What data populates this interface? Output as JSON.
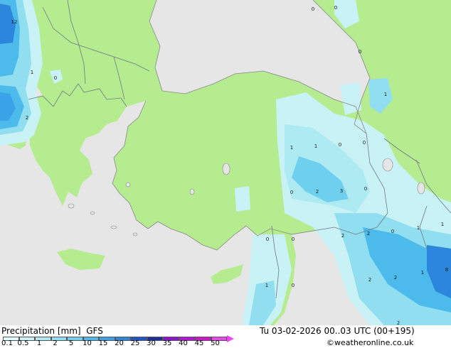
{
  "legend": {
    "title": "Precipitation [mm]",
    "model": "GFS",
    "datetime": "Tu 03-02-2026 00..03 UTC (00+195)",
    "credit": "©weatheronline.co.uk",
    "scale": [
      {
        "label": "0.1",
        "color": "#e0fafa"
      },
      {
        "label": "0.5",
        "color": "#c8f2f5"
      },
      {
        "label": "1",
        "color": "#aeeaf2"
      },
      {
        "label": "2",
        "color": "#90def0"
      },
      {
        "label": "5",
        "color": "#6ed0ee"
      },
      {
        "label": "10",
        "color": "#4cbbec"
      },
      {
        "label": "15",
        "color": "#3aa2e6"
      },
      {
        "label": "20",
        "color": "#2c86dc"
      },
      {
        "label": "25",
        "color": "#1f55c8"
      },
      {
        "label": "30",
        "color": "#1a2ea0"
      },
      {
        "label": "35",
        "color": "#8c14d2"
      },
      {
        "label": "40",
        "color": "#b414dc"
      },
      {
        "label": "45",
        "color": "#d214d2"
      },
      {
        "label": "50",
        "color": "#ee46f0"
      }
    ]
  },
  "map": {
    "colors": {
      "land": "#b5ec8f",
      "sea": "#e6e6e6",
      "border": "#6e7a86"
    },
    "labels": [
      "12",
      "1",
      "0",
      "2",
      "0",
      "0",
      "0",
      "1",
      "1",
      "1",
      "0",
      "0",
      "0",
      "2",
      "3",
      "0",
      "2",
      "0",
      "1",
      "0",
      "2",
      "0",
      "1",
      "0",
      "1",
      "2",
      "8",
      "2",
      "2",
      "1"
    ]
  }
}
